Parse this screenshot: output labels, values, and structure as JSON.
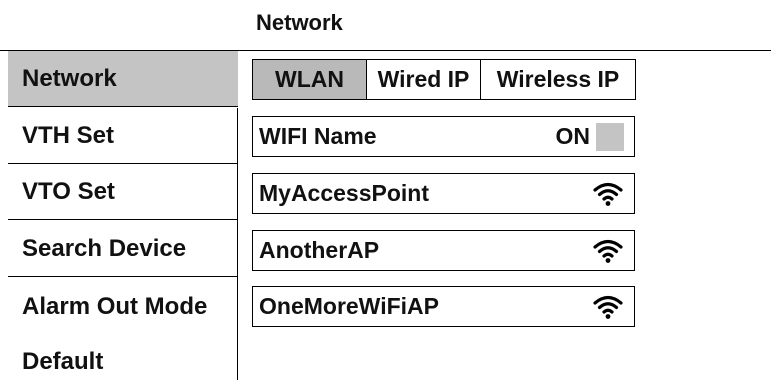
{
  "header": {
    "title": "Network"
  },
  "sidebar": {
    "items": [
      {
        "label": "Network",
        "active": true
      },
      {
        "label": "VTH Set"
      },
      {
        "label": "VTO Set"
      },
      {
        "label": "Search Device"
      },
      {
        "label": "Alarm Out Mode"
      },
      {
        "label": "Default"
      }
    ]
  },
  "tabs": [
    {
      "label": "WLAN",
      "active": true
    },
    {
      "label": "Wired IP"
    },
    {
      "label": "Wireless IP"
    }
  ],
  "wifi": {
    "name_label": "WIFI Name",
    "toggle_label": "ON",
    "networks": [
      {
        "ssid": "MyAccessPoint",
        "icon": "wifi-icon"
      },
      {
        "ssid": "AnotherAP",
        "icon": "wifi-icon"
      },
      {
        "ssid": "OneMoreWiFiAP",
        "icon": "wifi-icon"
      }
    ]
  },
  "colors": {
    "active_bg": "#c4c4c4",
    "border": "#000000"
  }
}
